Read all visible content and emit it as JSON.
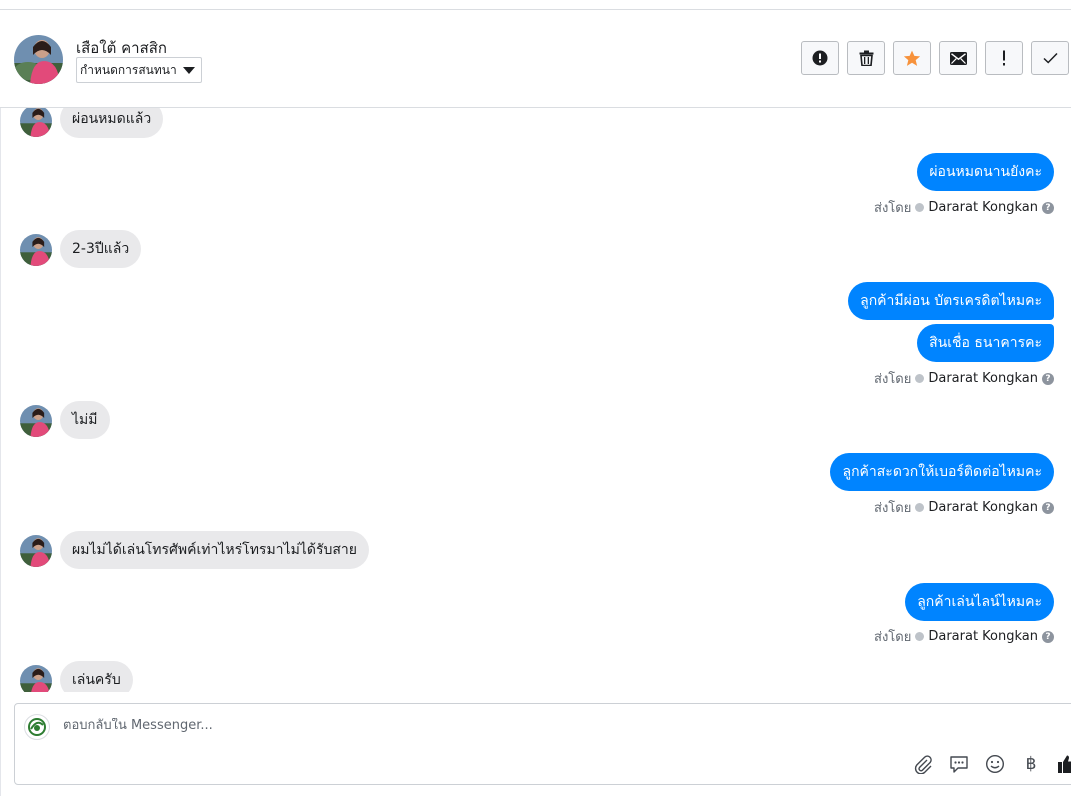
{
  "header": {
    "contact_name": "เสือใต้ คาสสิก",
    "assign_label": "กำหนดการสนทนา",
    "actions": [
      {
        "name": "report-button",
        "icon": "alert-circle-icon"
      },
      {
        "name": "delete-button",
        "icon": "trash-icon"
      },
      {
        "name": "star-button",
        "icon": "star-icon"
      },
      {
        "name": "mark-unread-button",
        "icon": "envelope-icon"
      },
      {
        "name": "important-button",
        "icon": "exclamation-icon"
      },
      {
        "name": "done-button",
        "icon": "check-icon"
      }
    ]
  },
  "messages": [
    {
      "from": "customer",
      "text": "ผ่อนหมดแล้ว"
    },
    {
      "from": "page",
      "text": "ผ่อนหมดนานยังคะ"
    },
    {
      "from": "customer",
      "text": "2-3ปีแล้ว"
    },
    {
      "from": "page",
      "text": "ลูกค้ามีผ่อน บัตรเครดิตไหมคะ"
    },
    {
      "from": "page",
      "text": "สินเชื่อ ธนาคารคะ"
    },
    {
      "from": "customer",
      "text": "ไม่มี"
    },
    {
      "from": "page",
      "text": "ลูกค้าสะดวกให้เบอร์ติดต่อไหมคะ"
    },
    {
      "from": "customer",
      "text": "ผมไม่ได้เล่นโทรศัพค์เท่าไหร่โทรมาไม่ได้รับสาย"
    },
    {
      "from": "page",
      "text": "ลูกค้าเล่นไลน์ไหมคะ"
    },
    {
      "from": "customer",
      "text": "เล่นครับ"
    }
  ],
  "sent_by": {
    "prefix": "ส่งโดย",
    "agent": "Dararat Kongkan"
  },
  "composer": {
    "placeholder": "ตอบกลับใน Messenger...",
    "currency_symbol": "฿"
  },
  "colors": {
    "outgoing_bubble": "#0084ff",
    "incoming_bubble": "#e9e9eb",
    "star": "#f7923b"
  }
}
